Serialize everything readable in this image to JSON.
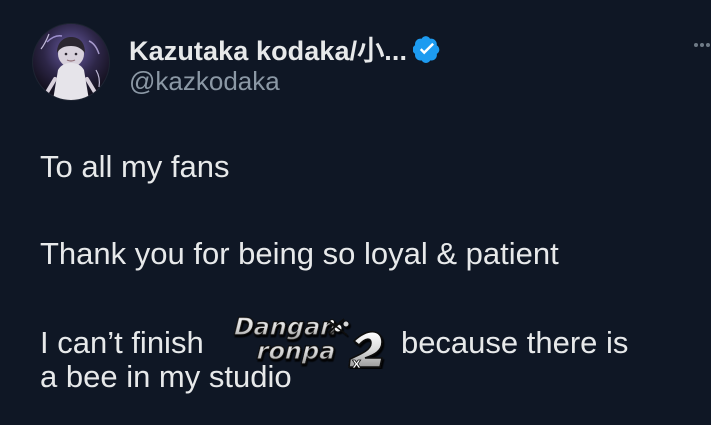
{
  "tweet": {
    "display_name": "Kazutaka kodaka/小...",
    "handle": "@kazkodaka",
    "verified": true,
    "avatar": "profile-avatar-image",
    "more_icon": "more-icon",
    "text": {
      "line1": "To all my fans",
      "line2": "Thank you for being so loyal & patient",
      "line3_before": "I can’t finish",
      "line3_after": "because there is",
      "line4": "a bee in my studio"
    },
    "inline_logo": {
      "word1": "Dangan",
      "word2": "ronpa",
      "number": "2",
      "mark": "x"
    },
    "colors": {
      "background": "#0f1725",
      "text": "#e7e9ea",
      "secondary": "#8b98a5",
      "verified": "#1d9bf0"
    }
  }
}
